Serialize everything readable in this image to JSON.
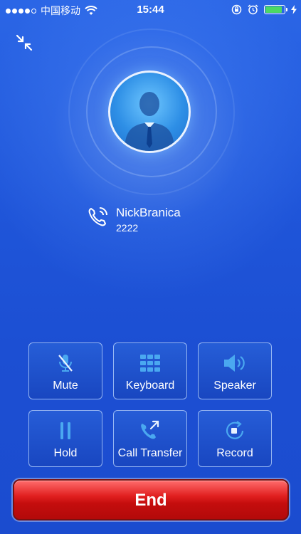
{
  "status_bar": {
    "carrier": "中国移动",
    "time": "15:44",
    "battery_color": "#4cd964",
    "battery_level": 0.9
  },
  "call": {
    "caller_name": "NickBranica",
    "caller_number": "2222"
  },
  "actions": [
    {
      "label": "Mute",
      "icon": "mute-icon"
    },
    {
      "label": "Keyboard",
      "icon": "keypad-icon"
    },
    {
      "label": "Speaker",
      "icon": "speaker-icon"
    },
    {
      "label": "Hold",
      "icon": "pause-icon"
    },
    {
      "label": "Call Transfer",
      "icon": "call-transfer-icon"
    },
    {
      "label": "Record",
      "icon": "record-icon"
    }
  ],
  "end_button": {
    "label": "End",
    "color": "#d91515"
  },
  "colors": {
    "background": "#1f55d9",
    "accent": "#4aa8f0"
  }
}
